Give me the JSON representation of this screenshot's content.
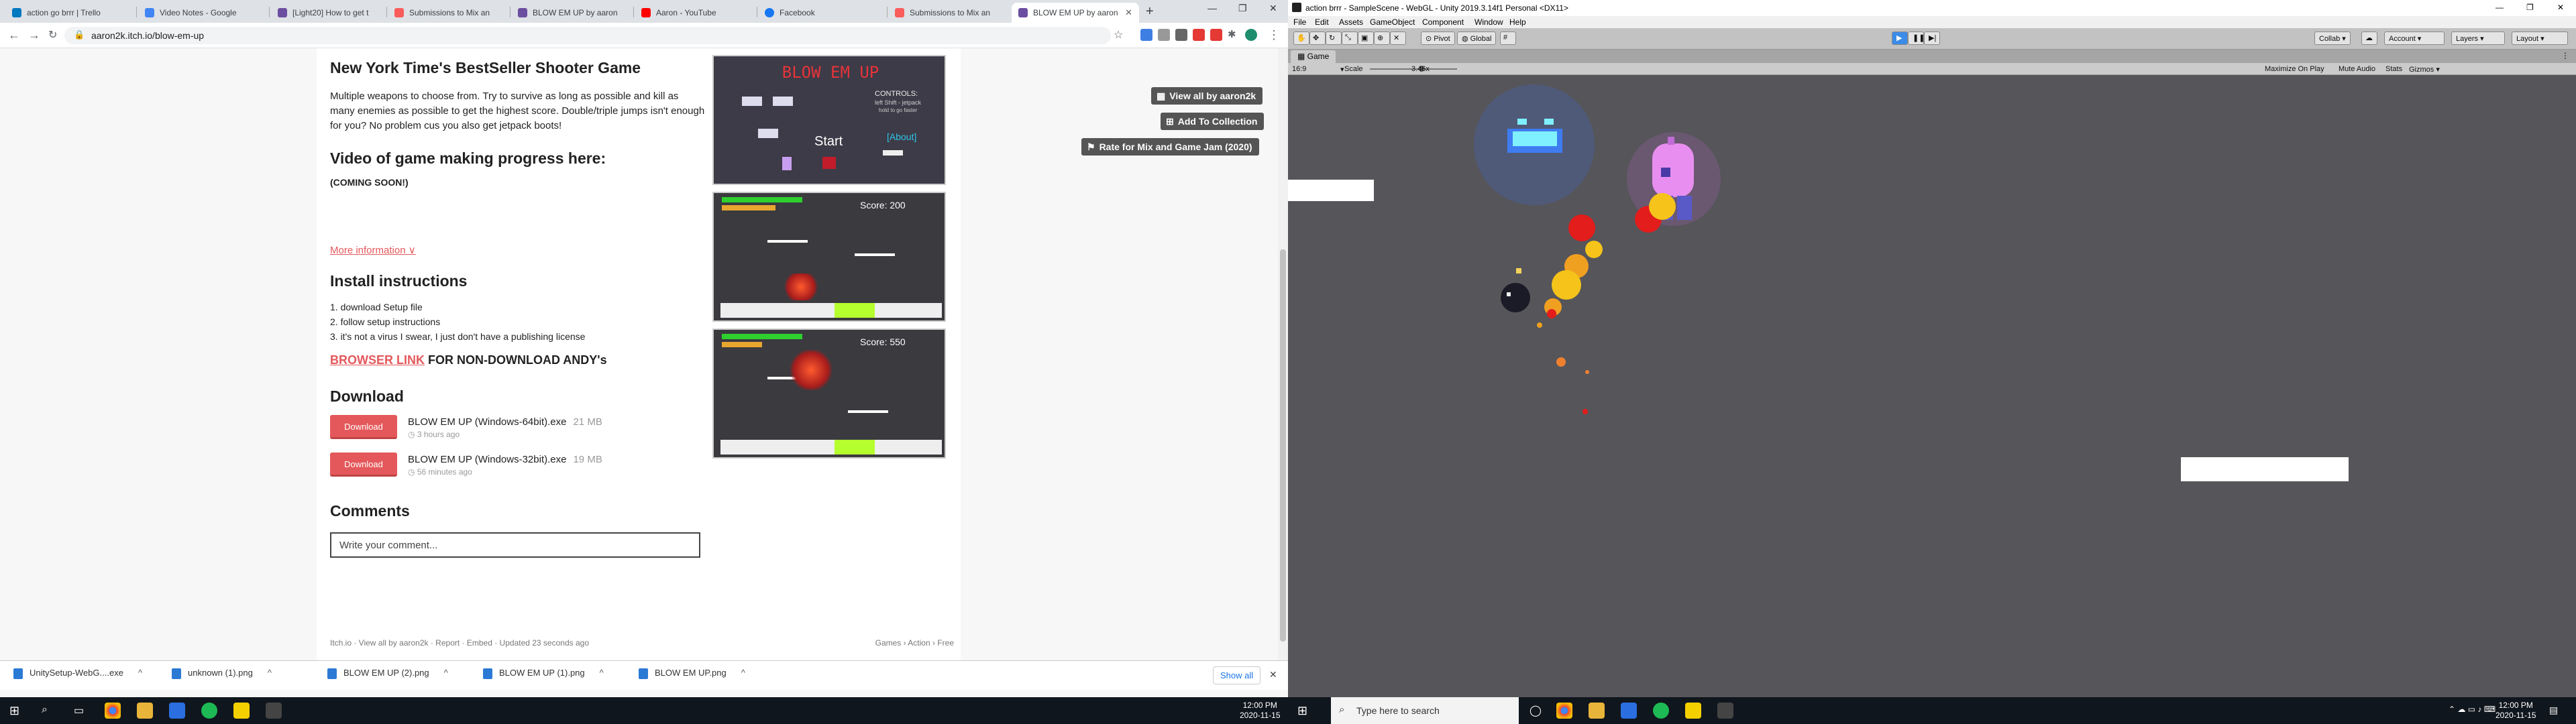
{
  "browser": {
    "tabs": [
      {
        "label": "action go brrr | Trello",
        "color": "#0079bf"
      },
      {
        "label": "Video Notes - Google",
        "color": "#4285f4"
      },
      {
        "label": "[Light20] How to get t",
        "color": "#6c4ea1"
      },
      {
        "label": "Submissions to Mix an",
        "color": "#fa5c5c"
      },
      {
        "label": "BLOW EM UP by aaron",
        "color": "#6c4ea1"
      },
      {
        "label": "Aaron - YouTube",
        "color": "#ff0000"
      },
      {
        "label": "Facebook",
        "color": "#1877f2"
      },
      {
        "label": "Submissions to Mix an",
        "color": "#fa5c5c"
      },
      {
        "label": "BLOW EM UP by aaron",
        "color": "#6c4ea1"
      }
    ],
    "url": "aaron2k.itch.io/blow-em-up",
    "new_tab": "+"
  },
  "game_page": {
    "title": "New York Time's BestSeller Shooter Game",
    "description": "Multiple weapons to choose from. Try to survive as long as possible and kill as many enemies as possible to get the highest score. Double/triple jumps isn't enough for you? No problem cus you also get jetpack boots!",
    "video_heading": "Video of game making progress here:",
    "coming_soon": "(COMING SOON!)",
    "more_info": "More information ∨",
    "install_heading": "Install instructions",
    "install_steps": [
      "1. download Setup file",
      "2. follow setup instructions",
      "3. it's not a virus I swear, I just don't have a publishing license"
    ],
    "browser_link": "BROWSER LINK",
    "browser_suffix": " FOR NON-DOWNLOAD ANDY's",
    "download_heading": "Download",
    "downloads": [
      {
        "button": "Download",
        "name": "BLOW EM UP (Windows-64bit).exe",
        "size": "21 MB",
        "time": "3 hours ago"
      },
      {
        "button": "Download",
        "name": "BLOW EM UP (Windows-32bit).exe",
        "size": "19 MB",
        "time": "56 minutes ago"
      }
    ],
    "comments_heading": "Comments",
    "comment_placeholder": "Write your comment...",
    "footer_left": "Itch.io · View all by aaron2k · Report · Embed · Updated 23 seconds ago",
    "footer_right": "Games › Action › Free",
    "side_buttons": {
      "view_all": "View all by aaron2k",
      "add_collection": "Add To Collection",
      "rate": "Rate for Mix and Game Jam (2020)"
    },
    "screenshots": {
      "title_text": "BLOW EM UP",
      "controls_title": "CONTROLS:",
      "controls_1": "left Shift - jetpack",
      "controls_2": "hold to go faster",
      "start": "Start",
      "about": "[About]",
      "score_1": "Score: 200",
      "score_2": "Score: 550"
    }
  },
  "download_shelf": {
    "items": [
      "UnitySetup-WebG....exe",
      "unknown (1).png",
      "BLOW EM UP (2).png",
      "BLOW EM UP (1).png",
      "BLOW EM UP.png"
    ],
    "show_all": "Show all"
  },
  "taskbar_left": {
    "time": "12:00 PM",
    "date": "2020-11-15"
  },
  "unity": {
    "title": "action brrr - SampleScene - WebGL - Unity 2019.3.14f1 Personal <DX11>",
    "menu": [
      "File",
      "Edit",
      "Assets",
      "GameObject",
      "Component",
      "Window",
      "Help"
    ],
    "pivot": "Pivot",
    "global": "Global",
    "collab": "Collab ▾",
    "account": "Account ▾",
    "layers": "Layers ▾",
    "layout": "Layout ▾",
    "game_tab": "Game",
    "aspect": "16:9",
    "scale_label": "Scale",
    "scale_value": "3.46x",
    "game_toggles": [
      "Maximize On Play",
      "Mute Audio",
      "Stats",
      "Gizmos ▾"
    ],
    "search_placeholder": "Type here to search",
    "time": "12:00 PM",
    "date": "2020-11-15"
  }
}
